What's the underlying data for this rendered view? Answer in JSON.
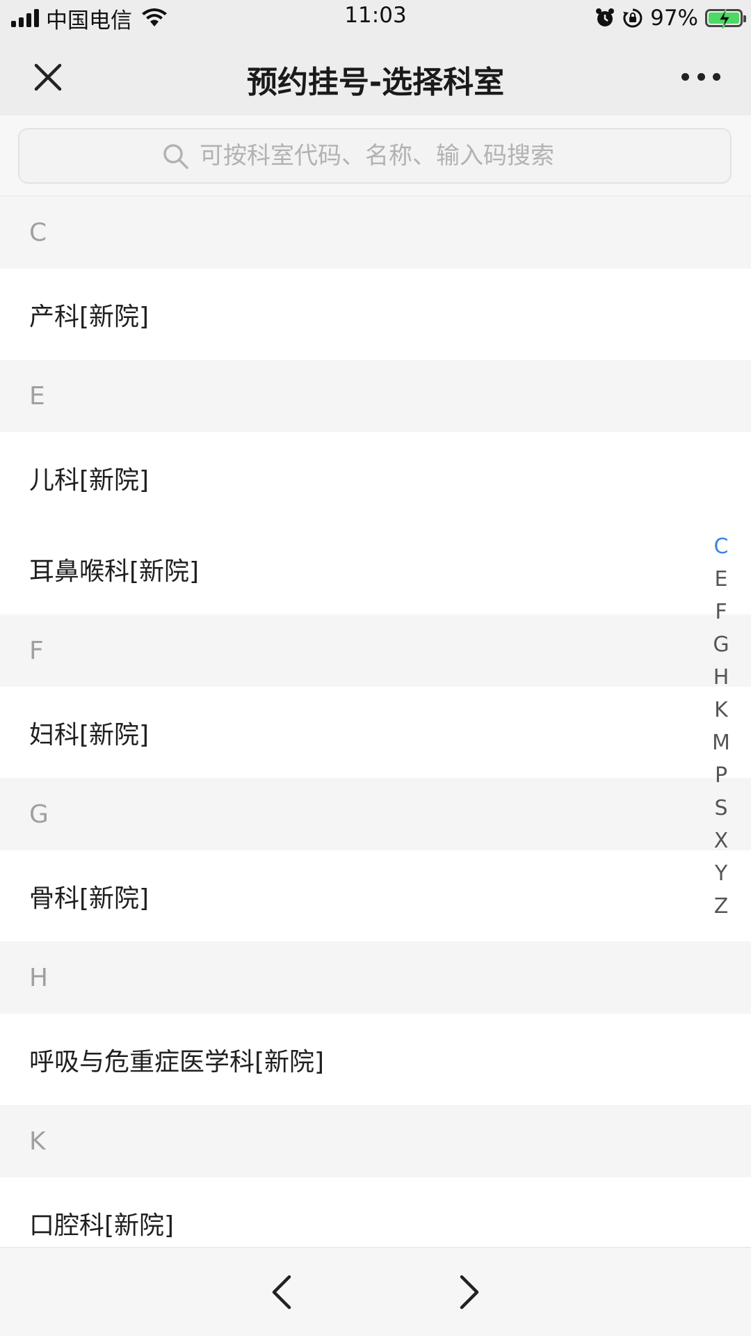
{
  "status_bar": {
    "carrier": "中国电信",
    "time": "11:03",
    "battery_percent": "97%",
    "icons": [
      "signal-icon",
      "wifi-icon",
      "alarm-icon",
      "rotation-lock-icon",
      "battery-charging-icon"
    ]
  },
  "nav": {
    "title": "预约挂号-选择科室",
    "close_icon": "close-icon",
    "more_icon": "more-icon"
  },
  "search": {
    "placeholder": "可按科室代码、名称、输入码搜索",
    "icon": "search-icon"
  },
  "groups": [
    {
      "letter": "C",
      "items": [
        "产科[新院]"
      ]
    },
    {
      "letter": "E",
      "items": [
        "儿科[新院]",
        "耳鼻喉科[新院]"
      ]
    },
    {
      "letter": "F",
      "items": [
        "妇科[新院]"
      ]
    },
    {
      "letter": "G",
      "items": [
        "骨科[新院]"
      ]
    },
    {
      "letter": "H",
      "items": [
        "呼吸与危重症医学科[新院]"
      ]
    },
    {
      "letter": "K",
      "items": [
        "口腔科[新院]"
      ]
    }
  ],
  "index_bar": {
    "letters": [
      "C",
      "E",
      "F",
      "G",
      "H",
      "K",
      "M",
      "P",
      "S",
      "X",
      "Y",
      "Z"
    ],
    "active": "C",
    "active_color": "#3b86d6"
  },
  "bottom_bar": {
    "back_icon": "chevron-left-icon",
    "forward_icon": "chevron-right-icon"
  }
}
